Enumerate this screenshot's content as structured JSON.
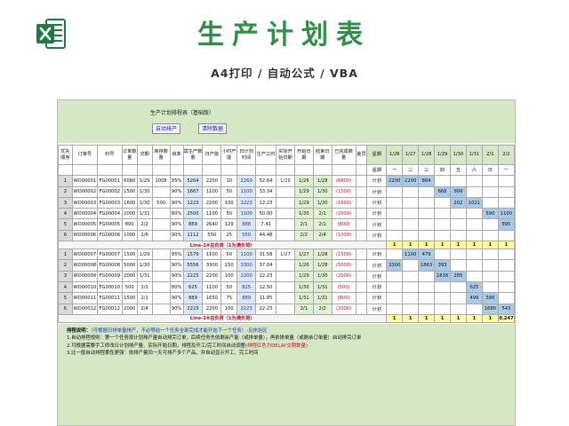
{
  "page": {
    "title": "生产计划表",
    "subtitle": "A4打印 / 自动公式 / VBA"
  },
  "sheet": {
    "title": "生产计划排程表（基础版）",
    "btn_auto": "自动排产",
    "btn_clear": "清除数据",
    "headers": [
      "优先顺序",
      "订单号",
      "料号",
      "订单数量",
      "交期",
      "库存数量",
      "良率",
      "需生产数量",
      "日产能",
      "小时产能",
      "日计划时间",
      "生产工时",
      "实际开始日期",
      "开始日期",
      "结束日期",
      "已完成数量",
      "差异",
      "星期"
    ],
    "date_header_label": "日期",
    "weekday_header_label": "星期",
    "dates": [
      "1/26",
      "1/27",
      "1/28",
      "1/29",
      "1/30",
      "1/31",
      "2/1",
      "2/2"
    ],
    "weekdays": [
      "一",
      "二",
      "三",
      "四",
      "五",
      "六",
      "日",
      "一"
    ],
    "group1": [
      {
        "n": "1",
        "o": "WO00001",
        "p": "FG00001",
        "q": "6080",
        "d": "1/29",
        "s": "1008",
        "y": "95%",
        "need": "5264",
        "cap": "2200",
        "hc": "10",
        "plan": "2260",
        "hrs": "52.64",
        "act": "1/26",
        "st": "1/26",
        "en": "1/28",
        "done": "(6800)",
        "diff": "计划",
        "vals": [
          "2200",
          "2200",
          "864",
          "",
          "",
          "",
          "",
          ""
        ]
      },
      {
        "n": "2",
        "o": "WO00002",
        "p": "FG00002",
        "q": "1500",
        "d": "1/30",
        "s": "",
        "y": "90%",
        "need": "1667",
        "cap": "1100",
        "hc": "50",
        "plan": "1100",
        "hrs": "33.34",
        "act": "",
        "st": "1/29",
        "en": "1/30",
        "done": "(1500)",
        "diff": "计划",
        "vals": [
          "",
          "",
          "",
          "668",
          "999",
          "",
          "",
          ""
        ]
      },
      {
        "n": "3",
        "o": "WO00003",
        "p": "FG00003",
        "q": "1600",
        "d": "1/30",
        "s": "500",
        "y": "90%",
        "need": "1223",
        "cap": "2200",
        "hc": "100",
        "plan": "1223",
        "hrs": "12.23",
        "act": "",
        "st": "1/29",
        "en": "1/30",
        "done": "(1600)",
        "diff": "计划",
        "vals": [
          "",
          "",
          "",
          "",
          "202",
          "1021",
          "",
          ""
        ]
      },
      {
        "n": "4",
        "o": "WO00004",
        "p": "FG00004",
        "q": "2000",
        "d": "1/31",
        "s": "",
        "y": "80%",
        "need": "2500",
        "cap": "1100",
        "hc": "50",
        "plan": "1100",
        "hrs": "50.00",
        "act": "",
        "st": "1/30",
        "en": "2/1",
        "done": "(2000)",
        "diff": "计划",
        "vals": [
          "",
          "",
          "",
          "",
          "",
          "",
          "590",
          "1100"
        ]
      },
      {
        "n": "5",
        "o": "WO00005",
        "p": "FG00005",
        "q": "800",
        "d": "2/2",
        "s": "",
        "y": "90%",
        "need": "889",
        "cap": "2640",
        "hc": "129",
        "plan": "888",
        "hrs": "7.41",
        "act": "",
        "st": "2/1",
        "en": "2/1",
        "done": "(800)",
        "diff": "计划",
        "vals": [
          "",
          "",
          "",
          "",
          "",
          "",
          "",
          "895"
        ]
      },
      {
        "n": "6",
        "o": "WO00006",
        "p": "FG00006",
        "q": "1000",
        "d": "2/6",
        "s": "",
        "y": "90%",
        "need": "1112",
        "cap": "550",
        "hc": "25",
        "plan": "550",
        "hrs": "44.48",
        "act": "",
        "st": "2/2",
        "en": "2/4",
        "done": "(1000)",
        "diff": "计划",
        "vals": [
          "",
          "",
          "",
          "",
          "",
          "",
          "",
          ""
        ]
      }
    ],
    "group1_summary": {
      "label": "Line-1#总负荷（1为满负荷）",
      "vals": [
        "1",
        "1",
        "1",
        "1",
        "1",
        "1",
        "1",
        "1"
      ]
    },
    "group2": [
      {
        "n": "1",
        "o": "WO00007",
        "p": "FG00007",
        "q": "1500",
        "d": "1/29",
        "s": "",
        "y": "95%",
        "need": "1579",
        "cap": "1100",
        "hc": "50",
        "plan": "1100",
        "hrs": "31.58",
        "act": "1/27",
        "st": "1/27",
        "en": "1/28",
        "done": "(1500)",
        "diff": "计划",
        "vals": [
          "",
          "1100",
          "479",
          "",
          "",
          "",
          "",
          ""
        ]
      },
      {
        "n": "2",
        "o": "WO00008",
        "p": "FG00008",
        "q": "5000",
        "d": "1/30",
        "s": "",
        "y": "90%",
        "need": "5556",
        "cap": "3300",
        "hc": "150",
        "plan": "3300",
        "hrs": "37.04",
        "act": "",
        "st": "1/26",
        "en": "1/28",
        "done": "(5000)",
        "diff": "计划",
        "vals": [
          "3300",
          "",
          "1863",
          "393",
          "",
          "",
          "",
          ""
        ]
      },
      {
        "n": "3",
        "o": "WO00009",
        "p": "FG00009",
        "q": "2000",
        "d": "1/31",
        "s": "",
        "y": "90%",
        "need": "2223",
        "cap": "2200",
        "hc": "100",
        "plan": "2200",
        "hrs": "22.23",
        "act": "",
        "st": "1/29",
        "en": "1/30",
        "done": "(2000)",
        "diff": "计划",
        "vals": [
          "",
          "",
          "",
          "1838",
          "285",
          "",
          "",
          ""
        ]
      },
      {
        "n": "4",
        "o": "WO00010",
        "p": "FG00010",
        "q": "500",
        "d": "2/1",
        "s": "",
        "y": "80%",
        "need": "625",
        "cap": "1100",
        "hc": "50",
        "plan": "825",
        "hrs": "12.50",
        "act": "",
        "st": "1/30",
        "en": "1/31",
        "done": "(500)",
        "diff": "计划",
        "vals": [
          "",
          "",
          "",
          "",
          "",
          "625",
          "",
          ""
        ]
      },
      {
        "n": "5",
        "o": "WO00011",
        "p": "FG00011",
        "q": "1500",
        "d": "2/1",
        "s": "",
        "y": "90%",
        "need": "889",
        "cap": "1650",
        "hc": "75",
        "plan": "889",
        "hrs": "11.85",
        "act": "",
        "st": "1/31",
        "en": "1/31",
        "done": "(800)",
        "diff": "计划",
        "vals": [
          "",
          "",
          "",
          "",
          "",
          "499",
          "390",
          ""
        ]
      },
      {
        "n": "6",
        "o": "WO00012",
        "p": "FG00012",
        "q": "2000",
        "d": "2/4",
        "s": "",
        "y": "90%",
        "need": "2223",
        "cap": "2200",
        "hc": "100",
        "plan": "2223",
        "hrs": "22.23",
        "act": "",
        "st": "2/1",
        "en": "2/2",
        "done": "(2000)",
        "diff": "计划",
        "vals": [
          "",
          "",
          "",
          "",
          "",
          "",
          "1680",
          "543"
        ]
      }
    ],
    "group2_summary": {
      "label": "Line-2#总负荷（1为满负荷）",
      "vals": [
        "1",
        "1",
        "1",
        "1",
        "1",
        "1",
        "1",
        "0.247"
      ]
    },
    "notes": {
      "title": "排程说明：",
      "title_extra": "（可根据日排单量排产，不必等前一个任务全部完成才能开始下一个任务）-见休验区",
      "line1": "1.自动排程规则：第一个任务按计划排产量自动排完订单，后续任务先依剩余产能（或排单量），再依排单量（或剩余订单量）自动排完订单",
      "line2a": "2.可根据需要手工修改日计划排产量、实际开始日期，排程及开工/完工时间自动调整",
      "line2b": "(排程红色为DELAY交期数量)",
      "line3": "3.比一般自动排程柔性更强：依排产量同一天可排产多个产品，并自动显示开工、完工时间"
    }
  }
}
